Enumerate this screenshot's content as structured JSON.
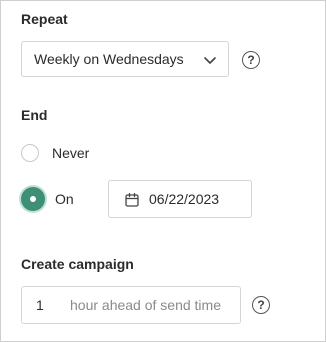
{
  "repeat": {
    "label": "Repeat",
    "selected": "Weekly on Wednesdays",
    "help_symbol": "?"
  },
  "end": {
    "label": "End",
    "options": [
      {
        "label": "Never",
        "checked": false
      },
      {
        "label": "On",
        "checked": true
      }
    ],
    "date": "06/22/2023"
  },
  "campaign": {
    "label": "Create campaign",
    "value": "1",
    "suffix": "hour ahead of send time",
    "help_symbol": "?"
  },
  "colors": {
    "accent": "#3f8f77",
    "accent_ring": "#bfe0d4",
    "border": "#d5d5d5"
  },
  "icons": {
    "repeat_select": "chevron-down-icon",
    "date_field": "calendar-icon",
    "help": "help-circle-icon"
  }
}
